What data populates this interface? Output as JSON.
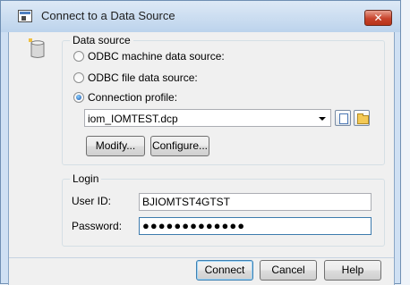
{
  "window": {
    "title": "Connect to a Data Source",
    "close_glyph": "✕"
  },
  "data_source": {
    "group_label": "Data source",
    "options": [
      {
        "label": "ODBC machine data source:",
        "checked": false
      },
      {
        "label": "ODBC file data source:",
        "checked": false
      },
      {
        "label": "Connection profile:",
        "checked": true
      }
    ],
    "profile_value": "iom_IOMTEST.dcp",
    "modify_label": "Modify...",
    "configure_label": "Configure..."
  },
  "login": {
    "group_label": "Login",
    "user_id_label": "User ID:",
    "user_id_value": "BJIOMTST4GTST",
    "password_label": "Password:",
    "password_value": "●●●●●●●●●●●●●"
  },
  "buttons": {
    "connect": "Connect",
    "cancel": "Cancel",
    "help": "Help"
  },
  "icons": [
    "app-icon",
    "database-icon",
    "dropdown-arrow-icon",
    "new-document-icon",
    "folder-icon"
  ],
  "colors": {
    "close_button": "#c7432c",
    "titlebar": "#cfe0f3",
    "focus_border": "#3d7bad"
  }
}
